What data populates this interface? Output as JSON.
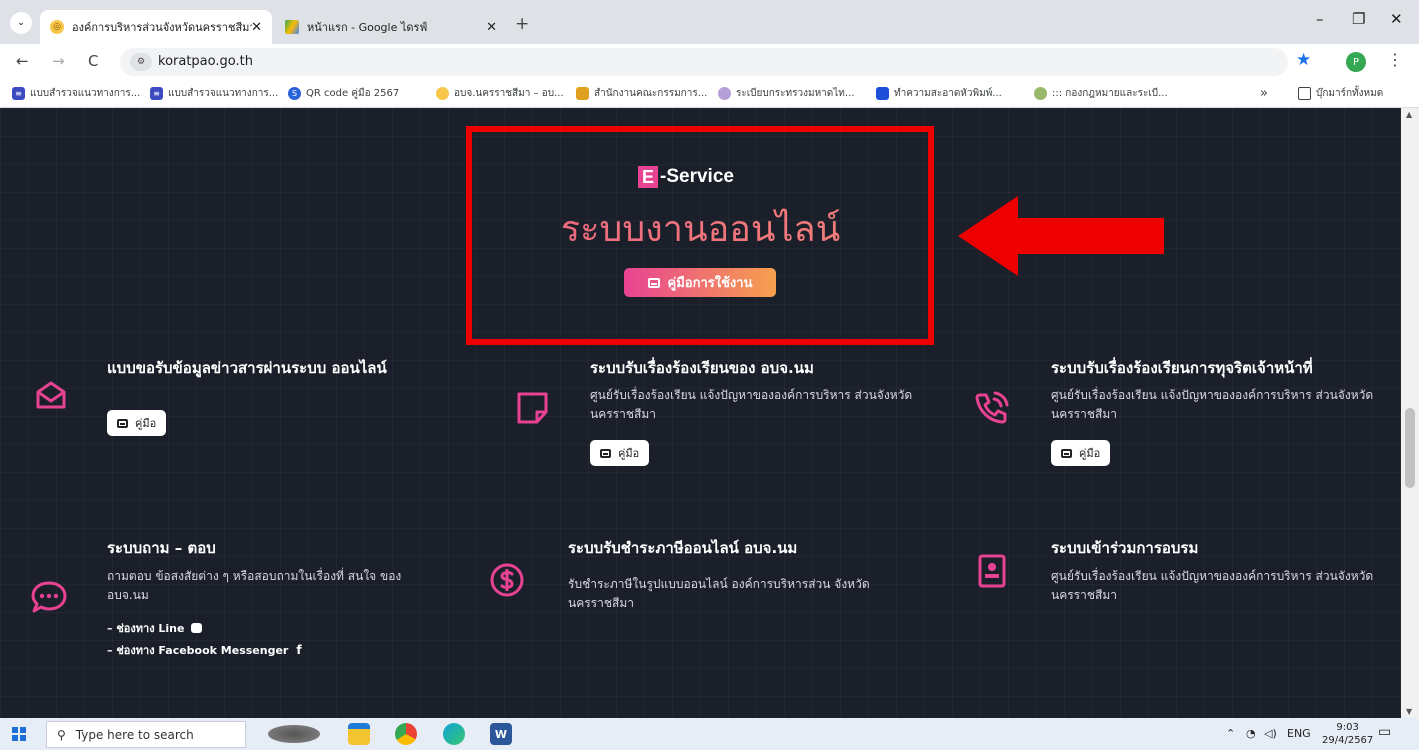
{
  "browser": {
    "tabs": [
      {
        "title": "องค์การบริหารส่วนจังหวัดนครราชสีมา",
        "close": "✕"
      },
      {
        "title": "หน้าแรก - Google ไดรฟ์",
        "close": "✕"
      }
    ],
    "new_tab": "+",
    "window_controls": {
      "minimize": "–",
      "maximize": "❐",
      "close": "✕"
    },
    "nav": {
      "back": "←",
      "forward": "→",
      "reload": "C"
    },
    "url": "koratpao.go.th",
    "profile_initial": "P",
    "bookmarks": [
      "แบบสำรวจแนวทางการ...",
      "แบบสำรวจแนวทางการ...",
      "QR code คู่มือ 2567",
      "อบจ.นครราชสีมา – อบ...",
      "สำนักงานคณะกรรมการ...",
      "ระเบียบกระทรวงมหาดไท...",
      "ทำความสะอาดหัวพิมพ์...",
      "::: กองกฎหมายและระเบี..."
    ],
    "bookmarks_overflow": "»",
    "all_bookmarks": "บุ๊กมาร์กทั้งหมด"
  },
  "hero": {
    "eservice_e": "E",
    "eservice_rest": "-Service",
    "title": "ระบบงานออนไลน์",
    "manual_button": "คู่มือการใช้งาน"
  },
  "services": [
    {
      "title": "แบบขอรับข้อมูลข่าวสารผ่านระบบ ออนไลน์",
      "button": "คู่มือ",
      "icon": "envelope-open-icon"
    },
    {
      "title": "ระบบรับเรื่องร้องเรียนของ อบจ.นม",
      "desc": "ศูนย์รับเรื่องร้องเรียน แจ้งปัญหาขององค์การบริหาร ส่วนจังหวัดนครราชสีมา",
      "button": "คู่มือ",
      "icon": "note-icon"
    },
    {
      "title": "ระบบรับเรื่องร้องเรียนการทุจริตเจ้าหน้าที่",
      "desc": "ศูนย์รับเรื่องร้องเรียน แจ้งปัญหาขององค์การบริหาร ส่วนจังหวัดนครราชสีมา",
      "button": "คู่มือ",
      "icon": "phone-call-icon"
    },
    {
      "title": "ระบบถาม – ตอบ",
      "desc": "ถามตอบ ข้อสงสัยต่าง ๆ หรือสอบถามในเรื่องที่ สนใจ ของ อบจ.นม",
      "link_line": "– ช่องทาง Line",
      "link_fb": "– ช่องทาง Facebook Messenger",
      "icon": "chat-bubble-icon"
    },
    {
      "title": "ระบบรับชำระภาษีออนไลน์ อบจ.นม",
      "desc": "รับชำระภาษีในรูปแบบออนไลน์ องค์การบริหารส่วน จังหวัดนครราชสีมา",
      "icon": "dollar-coin-icon"
    },
    {
      "title": "ระบบเข้าร่วมการอบรม",
      "desc": "ศูนย์รับเรื่องร้องเรียน แจ้งปัญหาขององค์การบริหาร ส่วนจังหวัดนครราชสีมา",
      "icon": "id-card-icon"
    }
  ],
  "taskbar": {
    "search_placeholder": "Type here to search",
    "lang": "ENG",
    "time": "9:03",
    "date": "29/4/2567"
  },
  "colors": {
    "accent_pink": "#e84393",
    "accent_orange": "#f6a04d",
    "highlight_red": "#ee0000",
    "page_bg": "#1a1f29"
  }
}
